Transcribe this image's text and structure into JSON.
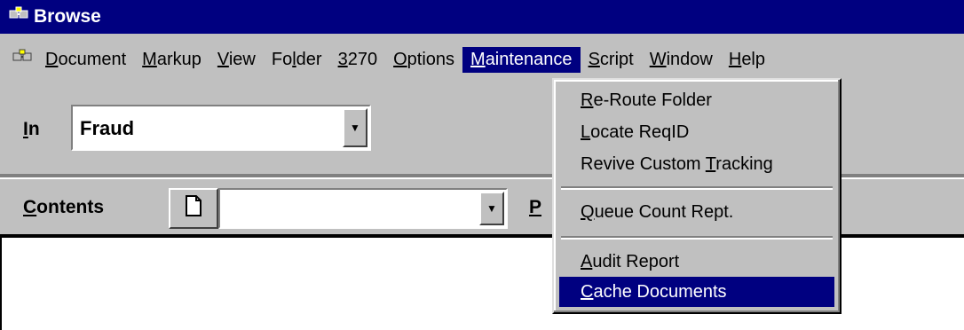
{
  "window": {
    "title": "Browse"
  },
  "menubar": {
    "items": [
      {
        "pre": "",
        "key": "D",
        "post": "ocument"
      },
      {
        "pre": "",
        "key": "M",
        "post": "arkup"
      },
      {
        "pre": "",
        "key": "V",
        "post": "iew"
      },
      {
        "pre": "Fo",
        "key": "l",
        "post": "der"
      },
      {
        "pre": "",
        "key": "3",
        "post": "270"
      },
      {
        "pre": "",
        "key": "O",
        "post": "ptions"
      },
      {
        "pre": "",
        "key": "M",
        "post": "aintenance"
      },
      {
        "pre": "",
        "key": "S",
        "post": "cript"
      },
      {
        "pre": "",
        "key": "W",
        "post": "indow"
      },
      {
        "pre": "",
        "key": "H",
        "post": "elp"
      }
    ],
    "active_index": 6
  },
  "toolbar": {
    "in_label": {
      "key": "I",
      "rest": "n"
    },
    "in_value": "Fraud",
    "contents_label": {
      "key": "C",
      "rest": "ontents"
    },
    "contents_value": "",
    "p_label": "P"
  },
  "maintenance_menu": {
    "items": [
      {
        "pre": "",
        "key": "R",
        "post": "e-Route Folder"
      },
      {
        "pre": "",
        "key": "L",
        "post": "ocate ReqID"
      },
      {
        "pre": "Revive Custom ",
        "key": "T",
        "post": "racking"
      },
      {
        "pre": "",
        "key": "Q",
        "post": "ueue Count Rept."
      },
      {
        "pre": "",
        "key": "A",
        "post": "udit Report"
      },
      {
        "pre": "",
        "key": "C",
        "post": "ache Documents"
      }
    ],
    "selected_index": 5
  }
}
